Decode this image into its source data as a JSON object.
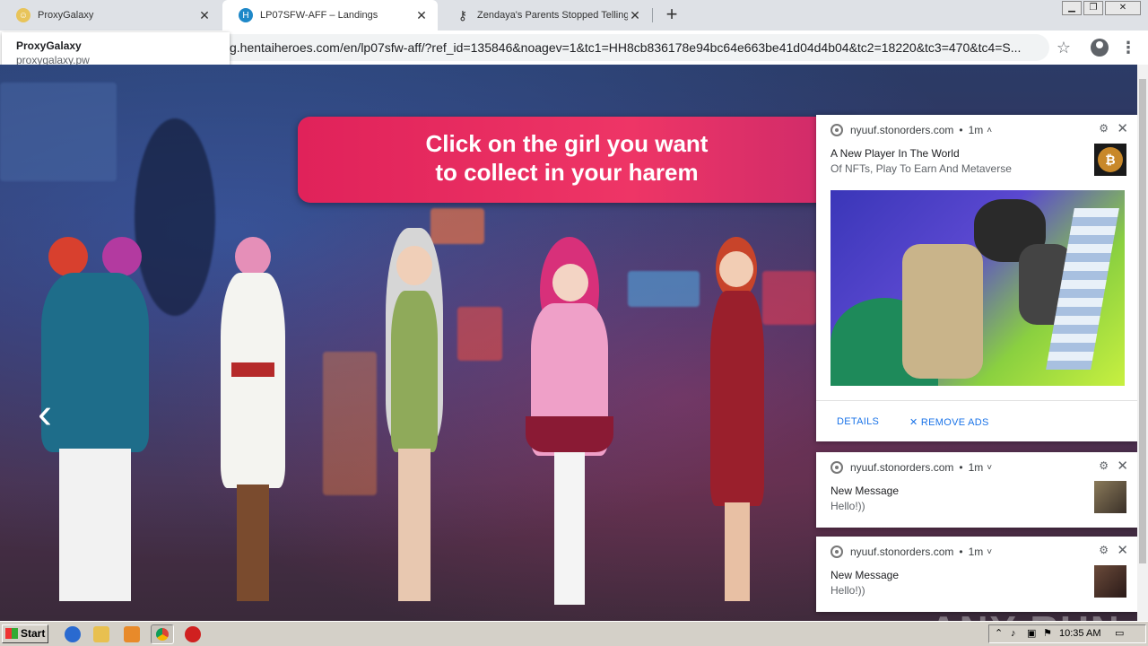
{
  "browser": {
    "tabs": [
      {
        "title": "ProxyGalaxy",
        "active": false
      },
      {
        "title": "LP07SFW-AFF – Landings",
        "active": true
      },
      {
        "title": "Zendaya's Parents Stopped Telling H",
        "active": false
      }
    ],
    "address": "g.hentaiheroes.com/en/lp07sfw-aff/?ref_id=135846&noagev=1&tc1=HH8cb836178e94bc64e663be41d04d4b04&tc2=18220&tc3=470&tc4=S...",
    "tooltip": {
      "title": "ProxyGalaxy",
      "url": "proxygalaxy.pw"
    }
  },
  "page": {
    "banner_text_line1": "Click on the girl you want",
    "banner_text_line2": "to collect in your harem",
    "prev_arrow": "‹"
  },
  "notifications": [
    {
      "site": "nyuuf.stonorders.com",
      "age": "1m",
      "title": "A New Player In The World",
      "body": "Of NFTs, Play To Earn And Metaverse",
      "actions": [
        "DETAILS",
        "REMOVE ADS"
      ]
    },
    {
      "site": "nyuuf.stonorders.com",
      "age": "1m",
      "title": "New Message",
      "body": "Hello!))"
    },
    {
      "site": "nyuuf.stonorders.com",
      "age": "1m",
      "title": "New Message",
      "body": "Hello!))"
    }
  ],
  "taskbar": {
    "start_label": "Start",
    "clock": "10:35 AM"
  },
  "watermark": "ANY RUN",
  "colors": {
    "banner": "#e0225a",
    "link_blue": "#1a73e8",
    "taskbar": "#d4d0c8"
  }
}
